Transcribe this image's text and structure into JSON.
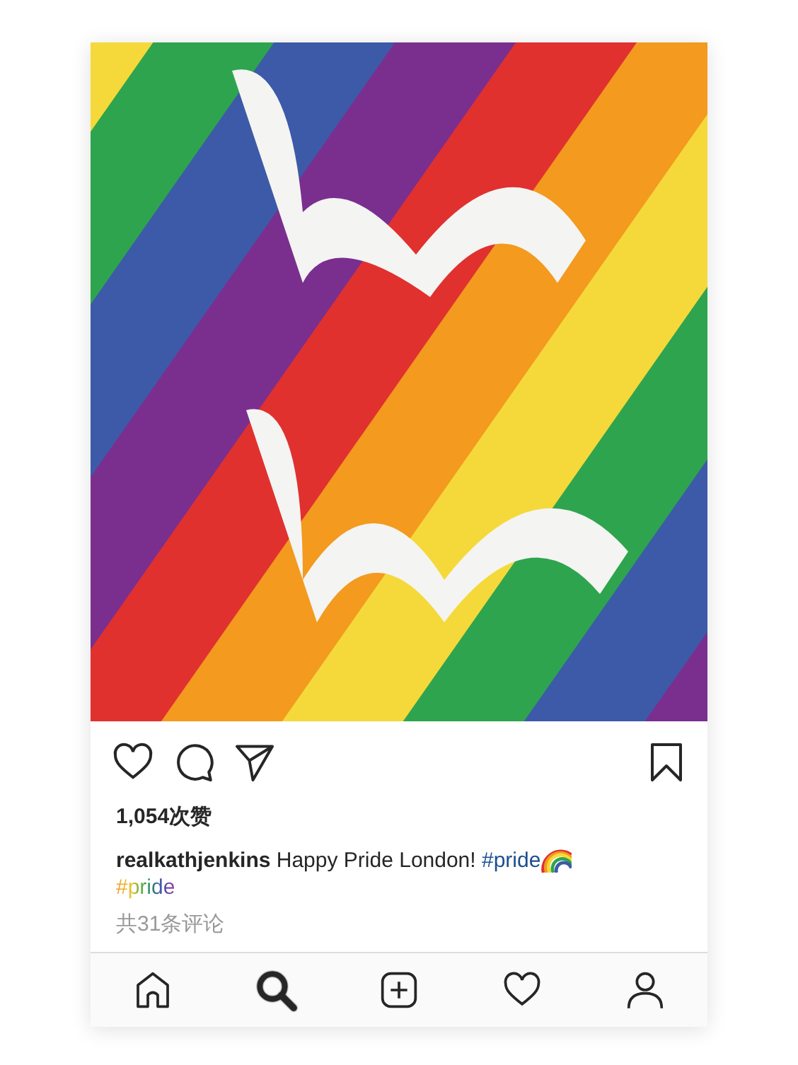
{
  "post": {
    "liked": false,
    "saved": false,
    "likes": "1,054次赞",
    "caption": {
      "text": "**realkathjenkins** Happy Pride London!",
      "hashtag": "#pride",
      "tag_line": "#pride"
    },
    "comments": "共31条评论"
  },
  "tabs": [
    {
      "kind": "home",
      "selected": false
    },
    {
      "kind": "search",
      "selected": true
    },
    {
      "kind": "add",
      "selected": false
    },
    {
      "kind": "activity",
      "selected": false
    },
    {
      "kind": "profile",
      "selected": false
    }
  ]
}
